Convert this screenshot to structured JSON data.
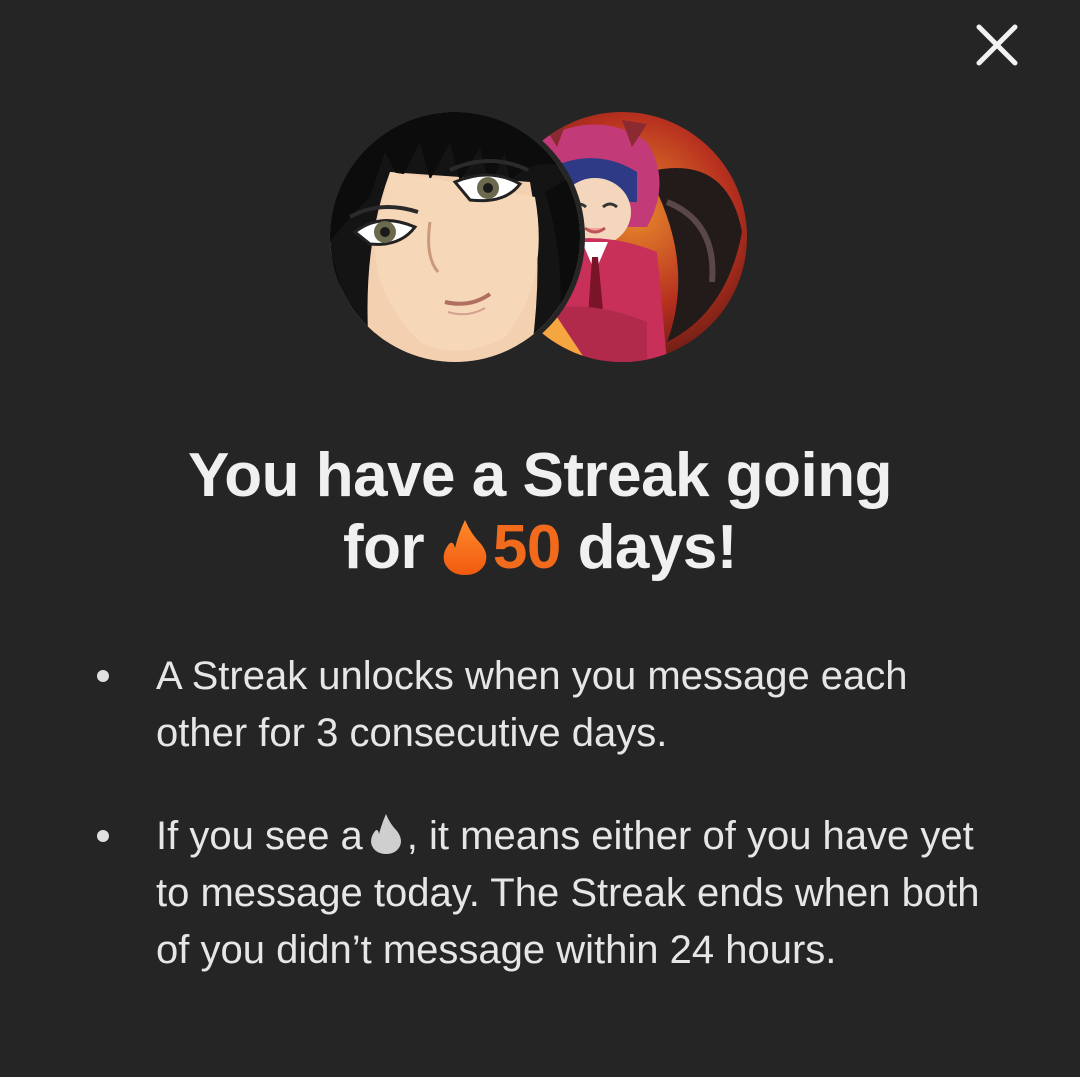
{
  "dialog": {
    "close_icon": "close-icon",
    "avatars": [
      {
        "name": "avatar-left",
        "icon": "anime-portrait-long-black-hair"
      },
      {
        "name": "avatar-right",
        "icon": "anime-character-red-hood"
      }
    ],
    "headline": {
      "part1": "You have a Streak going",
      "part2_prefix": "for",
      "flame_icon": "flame-icon",
      "count": "50",
      "part2_suffix": "days!"
    },
    "bullets": [
      {
        "text": "A Streak unlocks when you message each other for 3 consecutive days."
      },
      {
        "text_before": "If you see a",
        "icon": "grey-flame-icon",
        "text_after": ", it means either of you have yet to message today. The Streak ends when both of you didn’t message within 24 hours."
      }
    ]
  },
  "colors": {
    "background": "#252525",
    "text": "#f0f0f0",
    "accent": "#f26b1d",
    "grey_flame": "#cfcfcf"
  }
}
